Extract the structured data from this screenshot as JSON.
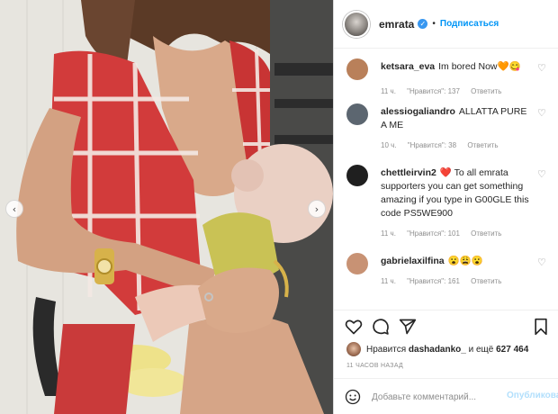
{
  "post": {
    "username": "emrata",
    "follow_label": "Подписаться",
    "dot": "•",
    "verified_glyph": "✓"
  },
  "photo": {
    "prev_glyph": "‹",
    "next_glyph": "›",
    "colors": {
      "shirt_red": "#d23b3b",
      "skin": "#d9a98a",
      "wall": "#e6e4de"
    }
  },
  "comments": [
    {
      "user": "ketsara_eva",
      "text": "Im bored Now🧡😋",
      "time": "11 ч.",
      "likes": "\"Нравится\": 137",
      "reply": "Ответить",
      "avatar_color": "#b9805a"
    },
    {
      "user": "alessiogaliandro",
      "text": "ALLATTA PURE A ME",
      "time": "10 ч.",
      "likes": "\"Нравится\": 38",
      "reply": "Ответить",
      "avatar_color": "#5c6670"
    },
    {
      "user": "chettleirvin2",
      "text": "❤️ To all emrata supporters you can get something amazing if you type in G00GLE this code PS5WE900",
      "time": "11 ч.",
      "likes": "\"Нравится\": 101",
      "reply": "Ответить",
      "avatar_color": "#1f1f1f"
    },
    {
      "user": "gabrielaxilfina",
      "text": "😮😩😮",
      "time": "11 ч.",
      "likes": "\"Нравится\": 161",
      "reply": "Ответить",
      "avatar_color": "#c89274"
    }
  ],
  "likes_line": {
    "prefix": "Нравится",
    "user": "dashadanko_",
    "suffix": "и ещё",
    "count": "627 464"
  },
  "timestamp": "11 ЧАСОВ НАЗАД",
  "comment_box": {
    "placeholder": "Добавьте комментарий...",
    "publish_label": "Опубликовать"
  },
  "icons": {
    "like": "heart-icon",
    "comment": "comment-icon",
    "share": "share-icon",
    "save": "bookmark-icon",
    "emoji": "emoji-icon"
  }
}
